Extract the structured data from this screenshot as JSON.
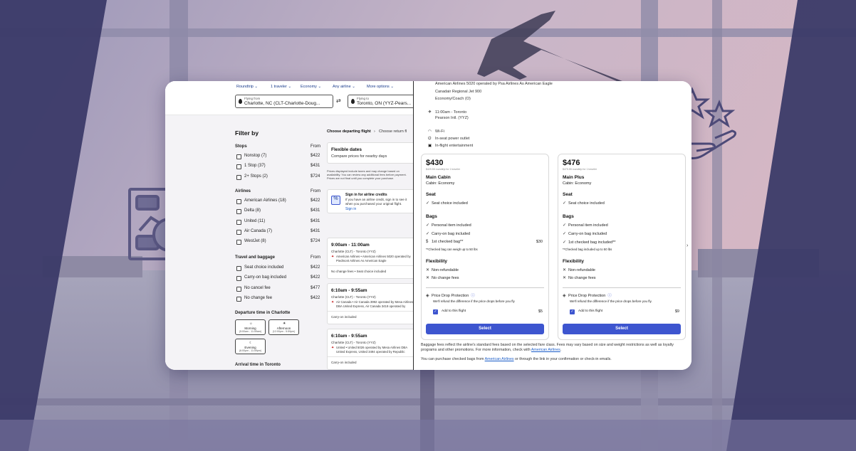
{
  "colors": {
    "accent": "#3d55cf",
    "link": "#1a5cc8",
    "bg_overlay": "#4b4a78"
  },
  "search": {
    "trip_type": "Roundtrip",
    "travelers": "1 traveler",
    "cabin": "Economy",
    "airline": "Any airline",
    "more_options": "More options",
    "from_caption": "Flying from",
    "from_value": "Charlotte, NC (CLT-Charlotte-Doug...",
    "to_caption": "Flying to",
    "to_value": "Toronto, ON (YYZ-Pears..."
  },
  "filters": {
    "title": "Filter by",
    "stops": {
      "heading": "Stops",
      "from_label": "From",
      "items": [
        {
          "label": "Nonstop (7)",
          "price": "$422"
        },
        {
          "label": "1 Stop (37)",
          "price": "$431"
        },
        {
          "label": "2+ Stops (2)",
          "price": "$724"
        }
      ]
    },
    "airlines": {
      "heading": "Airlines",
      "from_label": "From",
      "items": [
        {
          "label": "American Airlines (18)",
          "price": "$422"
        },
        {
          "label": "Delta (8)",
          "price": "$431"
        },
        {
          "label": "United (11)",
          "price": "$431"
        },
        {
          "label": "Air Canada (7)",
          "price": "$431"
        },
        {
          "label": "WestJet (8)",
          "price": "$724"
        }
      ]
    },
    "baggage": {
      "heading": "Travel and baggage",
      "from_label": "From",
      "items": [
        {
          "label": "Seat choice included",
          "price": "$422"
        },
        {
          "label": "Carry-on bag included",
          "price": "$422"
        },
        {
          "label": "No cancel fee",
          "price": "$477"
        },
        {
          "label": "No change fee",
          "price": "$422"
        }
      ]
    },
    "departure": {
      "heading": "Departure time in Charlotte",
      "slots": [
        {
          "label": "Morning",
          "range": "(5:00am - 11:59am)",
          "icon": "sunrise-icon"
        },
        {
          "label": "Afternoon",
          "range": "(12:00pm - 5:59pm)",
          "icon": "sun-icon"
        },
        {
          "label": "Evening",
          "range": "(6:00pm - 11:59pm)",
          "icon": "moon-icon"
        }
      ]
    },
    "arrival_heading": "Arrival time in Toronto"
  },
  "results": {
    "crumb_active": "Choose departing flight",
    "crumb_next": "Choose return fl",
    "flexible_title": "Flexible dates",
    "flexible_sub": "Compare prices for nearby days",
    "disclaimer": "Prices displayed include taxes and may change based on availability. You can review any additional fees before payment. Prices are not final until you complete your purchase.",
    "credit_title": "Sign in for airline credits",
    "credit_body": "If you have an airline credit, sign in to see it when you purchased your original flight.",
    "credit_link": "Sign in",
    "flights": [
      {
        "time": "9:00am - 11:00am",
        "route": "Charlotte (CLT) - Toronto (YYZ)",
        "carrier": "American Airlines • American Airlines 5020 operated by Piedmont Airlines As American Eagle",
        "footer": "No change fees • Seat choice included"
      },
      {
        "time": "6:10am - 9:55am",
        "route": "Charlotte (CLT) - Toronto (YYZ)",
        "carrier": "Air Canada • Air Canada 3992 operated by Mesa Airlines DBA United Express, Air Canada 3418 operated by Republic Airways",
        "footer": "Carry-on included"
      },
      {
        "time": "6:10am - 9:55am",
        "route": "Charlotte (CLT) - Toronto (YYZ)",
        "carrier": "United • United 5026 operated by Mesa Airlines DBA United Express, United 3494 operated by Republic Airways",
        "footer": "Carry-on included"
      }
    ]
  },
  "details": {
    "operated": "American Airlines 5020 operated by Psa Airlines As American Eagle",
    "aircraft": "Canadair Regional Jet 900",
    "cabin": "Economy/Coach (O)",
    "arrival_time": "11:00am - Toronto",
    "arrival_airport": "Pearson Intl. (YYZ)",
    "amenities": [
      "Wi-Fi",
      "In-seat power outlet",
      "In-flight entertainment"
    ],
    "fares": [
      {
        "price": "$430",
        "per_person": "$429.55 roundtrip for 1 traveler",
        "name": "Main Cabin",
        "cabin": "Cabin: Economy",
        "seat_heading": "Seat",
        "seat": "Seat choice included",
        "bags_heading": "Bags",
        "bags": [
          "Personal item included",
          "Carry-on bag included",
          "1st checked bag**"
        ],
        "bag_price": "$30",
        "bag_note": "**Checked bag can weigh up to 50 lbs",
        "flex_heading": "Flexibility",
        "flex": [
          "Non-refundable",
          "No change fees"
        ],
        "protect_title": "Price Drop Protection",
        "protect_body": "We'll refund the difference if the price drops before you fly",
        "addon": "Add to this flight",
        "addon_price": "$5",
        "select": "Select"
      },
      {
        "price": "$476",
        "per_person": "$475.55 roundtrip for 1 traveler",
        "name": "Main Plus",
        "cabin": "Cabin: Economy",
        "seat_heading": "Seat",
        "seat": "Seat choice included",
        "bags_heading": "Bags",
        "bags": [
          "Personal item included",
          "Carry-on bag included",
          "1st checked bag included**"
        ],
        "bag_price": "",
        "bag_note": "**Checked bag included up to 50 lbs",
        "flex_heading": "Flexibility",
        "flex": [
          "Non-refundable",
          "No change fees"
        ],
        "protect_title": "Price Drop Protection",
        "protect_body": "We'll refund the difference if the price drops before you fly.",
        "addon": "Add to this flight",
        "addon_price": "$9",
        "select": "Select"
      }
    ],
    "footnote_a": "Baggage fees reflect the airline's standard fees based on the selected fare class. Fees may vary based on size and weight restrictions as well as loyalty programs and other promotions. For more information, check with",
    "footnote_link": "American Airlines",
    "footnote_b": "You can purchase checked bags from",
    "footnote_link2": "American Airlines",
    "footnote_c": "or through the link in your confirmation or check-in emails."
  }
}
